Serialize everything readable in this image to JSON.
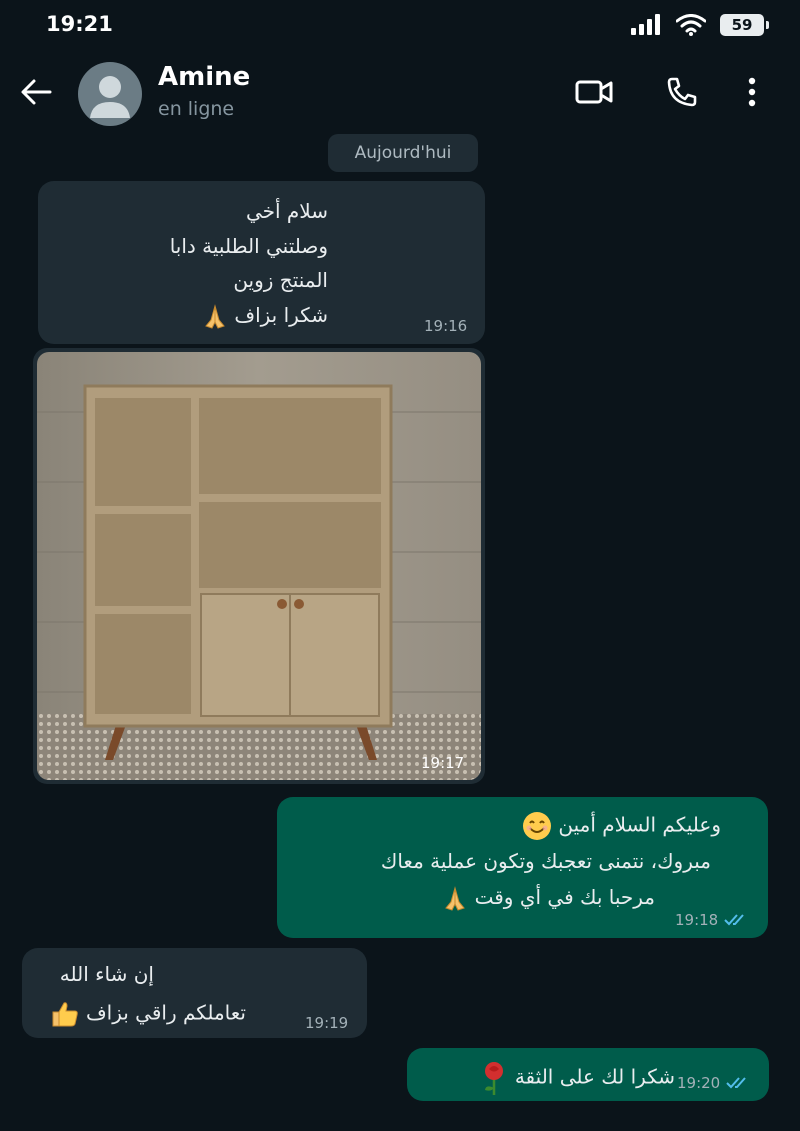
{
  "status_bar": {
    "time": "19:21",
    "battery": "59"
  },
  "header": {
    "name": "Amine",
    "status": "en ligne"
  },
  "date_chip": "Aujourd'hui",
  "messages": [
    {
      "lines": [
        "سلام أخي",
        "وصلتني الطلبية دابا",
        "المنتج زوين",
        "شكرا بزاف"
      ],
      "time": "19:16"
    },
    {
      "time": "19:17"
    },
    {
      "lines": [
        "وعليكم السلام أمين",
        "مبروك، نتمنى تعجبك وتكون عملية معاك",
        "مرحبا بك في أي وقت"
      ],
      "time": "19:18"
    },
    {
      "lines": [
        "إن شاء الله",
        "تعاملكم راقي بزاف"
      ],
      "time": "19:19"
    },
    {
      "lines": [
        "شكرا لك على الثقة"
      ],
      "time": "19:20"
    }
  ],
  "colors": {
    "background": "#0b141a",
    "incoming": "#1f2c34",
    "outgoing": "#005c4b",
    "read_ticks": "#53bdeb"
  }
}
